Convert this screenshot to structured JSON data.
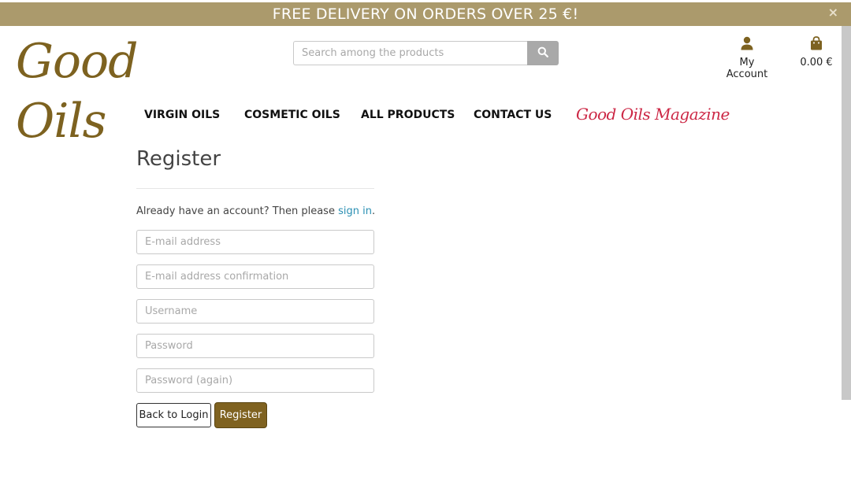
{
  "banner": {
    "text": "FREE DELIVERY ON ORDERS OVER 25 €!",
    "close_glyph": "×",
    "background": "#ab9a6c"
  },
  "header": {
    "logo_text": "Good Oils",
    "logo_color": "#7d6220",
    "search": {
      "placeholder": "Search among the products",
      "button_icon": "search-icon"
    },
    "account": {
      "icon": "user-icon",
      "label": "My Account"
    },
    "cart": {
      "icon": "shopping-bag-icon",
      "total": "0.00 €"
    }
  },
  "nav": {
    "items": [
      {
        "label": "VIRGIN OILS"
      },
      {
        "label": "COSMETIC OILS"
      },
      {
        "label": "ALL PRODUCTS"
      },
      {
        "label": "CONTACT US"
      }
    ],
    "magazine_label": "Good Oils Magazine",
    "magazine_color": "#cc2745"
  },
  "register_form": {
    "title": "Register",
    "signin_prompt": "Already have an account? Then please ",
    "signin_link": "sign in",
    "signin_suffix": ".",
    "fields": {
      "email": {
        "placeholder": "E-mail address",
        "value": ""
      },
      "email_confirm": {
        "placeholder": "E-mail address confirmation",
        "value": ""
      },
      "username": {
        "placeholder": "Username",
        "value": ""
      },
      "password": {
        "placeholder": "Password",
        "value": ""
      },
      "password_again": {
        "placeholder": "Password (again)",
        "value": ""
      }
    },
    "back_button": "Back to Login",
    "register_button": "Register",
    "accent_color": "#7f6220",
    "link_color": "#2a8fb3"
  }
}
